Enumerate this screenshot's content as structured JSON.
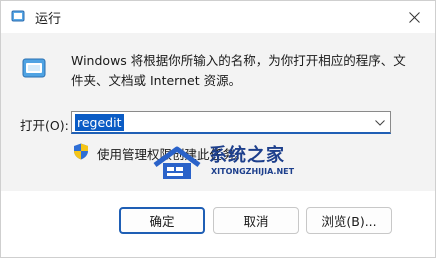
{
  "window": {
    "title": "运行",
    "close_icon": "close-icon",
    "accent_color": "#0b5cc5"
  },
  "dialog": {
    "description": "Windows 将根据你所输入的名称，为你打开相应的程序、文件夹、文档或 Internet 资源。",
    "open_label": "打开(O):",
    "open_value": "regedit",
    "admin_note": "使用管理权限创建此任务。"
  },
  "buttons": {
    "ok": "确定",
    "cancel": "取消",
    "browse": "浏览(B)..."
  },
  "watermark": {
    "title": "系统之家",
    "subtitle": "XITONGZHIJIA.NET"
  }
}
